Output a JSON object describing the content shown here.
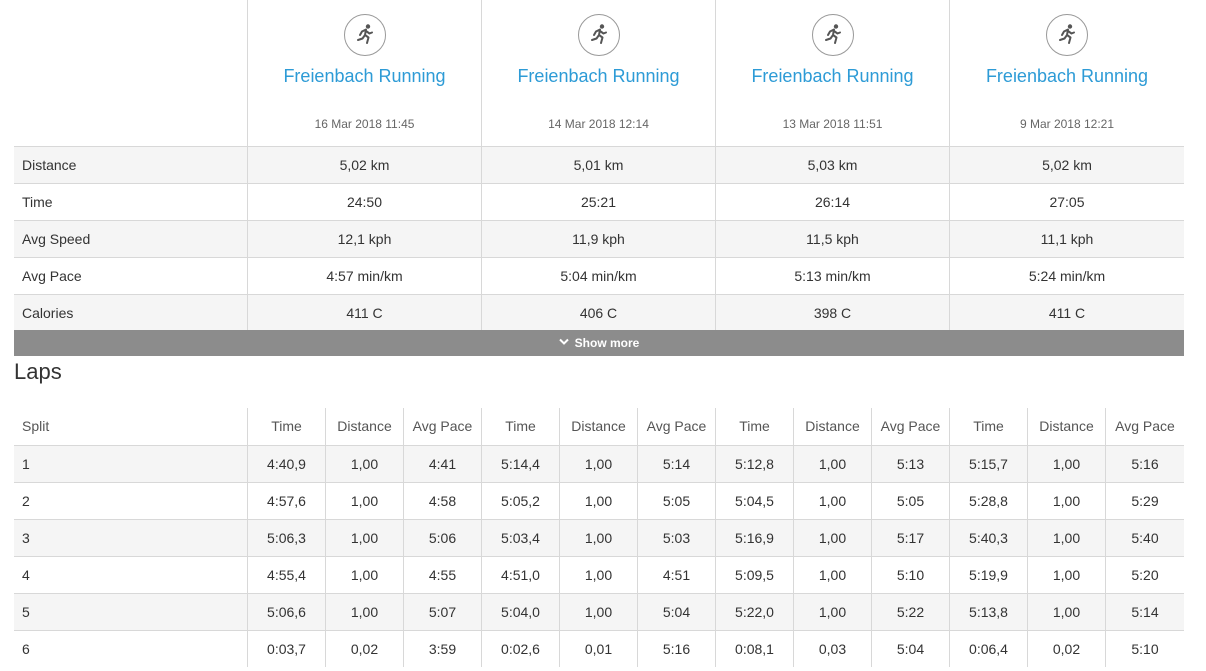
{
  "activities": [
    {
      "title": "Freienbach Running",
      "date": "16 Mar 2018 11:45",
      "distance": "5,02 km",
      "time": "24:50",
      "avg_speed": "12,1 kph",
      "avg_pace": "4:57 min/km",
      "calories": "411 C"
    },
    {
      "title": "Freienbach Running",
      "date": "14 Mar 2018 12:14",
      "distance": "5,01 km",
      "time": "25:21",
      "avg_speed": "11,9 kph",
      "avg_pace": "5:04 min/km",
      "calories": "406 C"
    },
    {
      "title": "Freienbach Running",
      "date": "13 Mar 2018 11:51",
      "distance": "5,03 km",
      "time": "26:14",
      "avg_speed": "11,5 kph",
      "avg_pace": "5:13 min/km",
      "calories": "398 C"
    },
    {
      "title": "Freienbach Running",
      "date": "9 Mar 2018 12:21",
      "distance": "5,02 km",
      "time": "27:05",
      "avg_speed": "11,1 kph",
      "avg_pace": "5:24 min/km",
      "calories": "411 C"
    }
  ],
  "summary_labels": {
    "distance": "Distance",
    "time": "Time",
    "avg_speed": "Avg Speed",
    "avg_pace": "Avg Pace",
    "calories": "Calories"
  },
  "show_more_label": "Show more",
  "laps": {
    "title": "Laps",
    "headers": {
      "split": "Split",
      "time": "Time",
      "distance": "Distance",
      "avg_pace": "Avg Pace"
    },
    "rows": [
      {
        "split": "1",
        "cells": [
          [
            "4:40,9",
            "1,00",
            "4:41"
          ],
          [
            "5:14,4",
            "1,00",
            "5:14"
          ],
          [
            "5:12,8",
            "1,00",
            "5:13"
          ],
          [
            "5:15,7",
            "1,00",
            "5:16"
          ]
        ]
      },
      {
        "split": "2",
        "cells": [
          [
            "4:57,6",
            "1,00",
            "4:58"
          ],
          [
            "5:05,2",
            "1,00",
            "5:05"
          ],
          [
            "5:04,5",
            "1,00",
            "5:05"
          ],
          [
            "5:28,8",
            "1,00",
            "5:29"
          ]
        ]
      },
      {
        "split": "3",
        "cells": [
          [
            "5:06,3",
            "1,00",
            "5:06"
          ],
          [
            "5:03,4",
            "1,00",
            "5:03"
          ],
          [
            "5:16,9",
            "1,00",
            "5:17"
          ],
          [
            "5:40,3",
            "1,00",
            "5:40"
          ]
        ]
      },
      {
        "split": "4",
        "cells": [
          [
            "4:55,4",
            "1,00",
            "4:55"
          ],
          [
            "4:51,0",
            "1,00",
            "4:51"
          ],
          [
            "5:09,5",
            "1,00",
            "5:10"
          ],
          [
            "5:19,9",
            "1,00",
            "5:20"
          ]
        ]
      },
      {
        "split": "5",
        "cells": [
          [
            "5:06,6",
            "1,00",
            "5:07"
          ],
          [
            "5:04,0",
            "1,00",
            "5:04"
          ],
          [
            "5:22,0",
            "1,00",
            "5:22"
          ],
          [
            "5:13,8",
            "1,00",
            "5:14"
          ]
        ]
      },
      {
        "split": "6",
        "cells": [
          [
            "0:03,7",
            "0,02",
            "3:59"
          ],
          [
            "0:02,6",
            "0,01",
            "5:16"
          ],
          [
            "0:08,1",
            "0,03",
            "5:04"
          ],
          [
            "0:06,4",
            "0,02",
            "5:10"
          ]
        ]
      }
    ]
  },
  "icons": {
    "activity": "running-icon",
    "show_more": "chevron-down-icon"
  },
  "colors": {
    "link": "#2d9bd6",
    "show_more_bg": "#8c8c8c",
    "row_alt": "#f5f5f5",
    "border": "#d8d8d8"
  }
}
